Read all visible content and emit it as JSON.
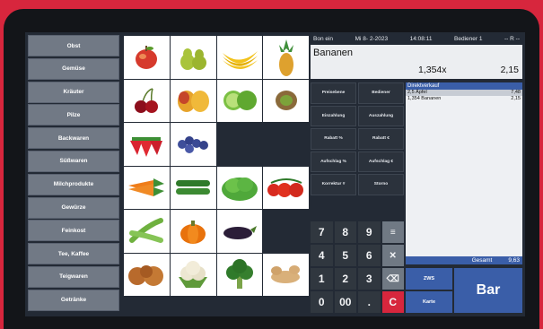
{
  "categories": [
    "Obst",
    "Gemüse",
    "Kräuter",
    "Pilze",
    "Backwaren",
    "Süßwaren",
    "Milchprodukte",
    "Gewürze",
    "Feinkost",
    "Tee, Kaffee",
    "Teigwaren",
    "Getränke"
  ],
  "products": [
    [
      "apple-icon",
      "pear-icon",
      "banana-icon",
      "pineapple-icon"
    ],
    [
      "cherry-icon",
      "mango-icon",
      "lime-icon",
      "kiwi-icon"
    ],
    [
      "strawberry-icon",
      "blueberry-icon",
      "",
      ""
    ],
    [
      "carrot-icon",
      "cucumber-icon",
      "lettuce-icon",
      "tomato-icon"
    ],
    [
      "beans-icon",
      "pumpkin-icon",
      "eggplant-icon",
      ""
    ],
    [
      "onion-icon",
      "cauliflower-icon",
      "broccoli-icon",
      "ginger-icon"
    ]
  ],
  "status": {
    "label": "Bon ein",
    "date": "Mi  8- 2-2023",
    "time": "14:08:11",
    "operator": "Bediener 1",
    "mode": "-- R --"
  },
  "display": {
    "name": "Bananen",
    "qty": "1,354x",
    "price": "2,15"
  },
  "functions": [
    [
      "Preisebene",
      "Bediener"
    ],
    [
      "Einzahlung",
      "Auszahlung"
    ],
    [
      "Rabatt %",
      "Rabatt €"
    ],
    [
      "Aufschlag %",
      "Aufschlag €"
    ],
    [
      "Korrektur #",
      "Storno"
    ]
  ],
  "receipt": {
    "title": "Direktverkauf",
    "lines": [
      {
        "text": "2,5 Äpfel",
        "amount": "7,48"
      },
      {
        "text": "1,354 Bananen",
        "amount": "2,15"
      }
    ],
    "total_label": "Gesamt",
    "total_value": "9,63"
  },
  "keypad": [
    [
      "7",
      "8",
      "9",
      "≡"
    ],
    [
      "4",
      "5",
      "6",
      "✕"
    ],
    [
      "1",
      "2",
      "3",
      "⌫"
    ],
    [
      "0",
      "00",
      ".",
      "C"
    ]
  ],
  "pay": {
    "zws": "ZWS",
    "karte": "Karte",
    "bar": "Bar"
  }
}
